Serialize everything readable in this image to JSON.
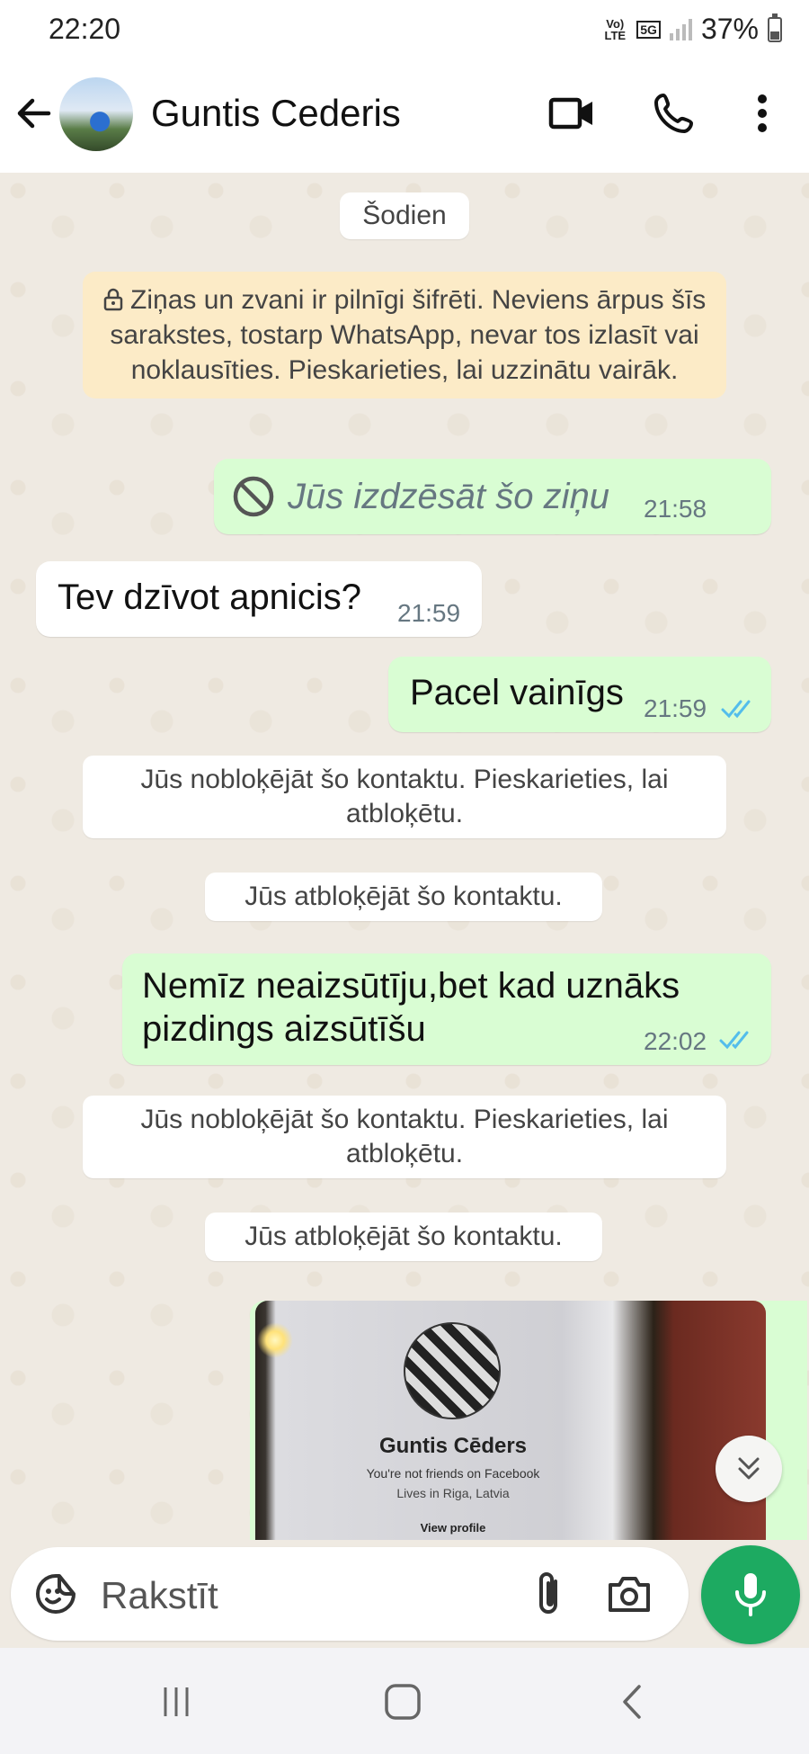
{
  "status_bar": {
    "time": "22:20",
    "volte": "Vo) LTE",
    "network": "5G",
    "battery": "37%"
  },
  "header": {
    "contact_name": "Guntis Cederis",
    "icons": [
      "back-arrow-icon",
      "video-call-icon",
      "phone-call-icon",
      "more-options-icon"
    ]
  },
  "chat": {
    "date_label": "Šodien",
    "encryption_notice": "Ziņas un zvani ir pilnīgi šifrēti. Neviens ārpus šīs sarakstes, tostarp WhatsApp, nevar tos izlasīt vai noklausīties. Pieskarieties, lai uzzinātu vairāk.",
    "messages": [
      {
        "direction": "outgoing",
        "type": "deleted",
        "text": "Jūs izdzēsāt šo ziņu",
        "time": "21:58"
      },
      {
        "direction": "incoming",
        "type": "text",
        "text": "Tev dzīvot apnicis?",
        "time": "21:59"
      },
      {
        "direction": "outgoing",
        "type": "text",
        "text": "Pacel vainīgs",
        "time": "21:59",
        "status": "read"
      },
      {
        "direction": "outgoing",
        "type": "text",
        "text": "Nemīz neaizsūtīju,bet kad uznāks pizdings aizsūtīšu",
        "time": "22:02",
        "status": "read"
      }
    ],
    "system_notices": [
      "Jūs nobloķējāt šo kontaktu. Pieskarieties, lai atbloķētu.",
      "Jūs atbloķējāt šo kontaktu.",
      "Jūs nobloķējāt šo kontaktu. Pieskarieties, lai atbloķētu.",
      "Jūs atbloķējāt šo kontaktu."
    ],
    "image_message": {
      "profile_name": "Guntis Cēders",
      "line1": "You're not friends on Facebook",
      "line2": "Lives in Riga, Latvia",
      "line3": "View profile"
    }
  },
  "input": {
    "placeholder": "Rakstīt"
  },
  "colors": {
    "outgoing_bubble": "#d9fdd3",
    "incoming_bubble": "#ffffff",
    "chat_background": "#efeae2",
    "encryption_bg": "#fcebc7",
    "accent_green": "#1daa61",
    "read_tick": "#53bdeb"
  }
}
